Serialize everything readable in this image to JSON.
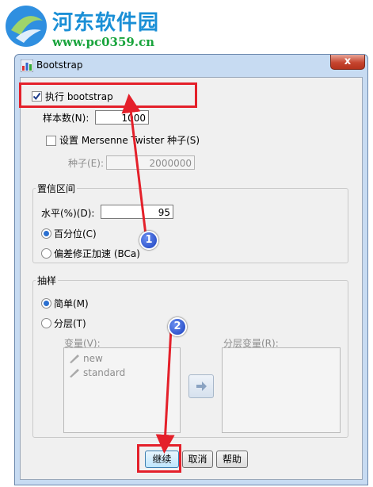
{
  "watermark": {
    "title": "河东软件园",
    "url": "www.pc0359.cn"
  },
  "window": {
    "title": "Bootstrap",
    "close": "x"
  },
  "bootstrap": {
    "label": "执行 bootstrap",
    "checked": true
  },
  "samples": {
    "label": "样本数(N):",
    "value": "1000"
  },
  "mersenne": {
    "label": "设置 Mersenne Twister 种子(S)",
    "checked": false
  },
  "seed": {
    "label": "种子(E):",
    "value": "2000000"
  },
  "ci": {
    "group": "置信区间",
    "level_label": "水平(%)(D):",
    "level_value": "95",
    "percentile": "百分位(C)",
    "bca": "偏差修正加速 (BCa)",
    "selected": "percentile"
  },
  "sampling": {
    "group": "抽样",
    "simple": "简单(M)",
    "stratified": "分层(T)",
    "selected": "simple",
    "variables_label": "变量(V):",
    "variables": [
      "new",
      "standard"
    ],
    "strata_label": "分层变量(R):"
  },
  "buttons": {
    "continue": "继续",
    "cancel": "取消",
    "help": "帮助"
  },
  "annotations": {
    "badge1": "1",
    "badge2": "2",
    "highlight_color": "#e4202a"
  }
}
